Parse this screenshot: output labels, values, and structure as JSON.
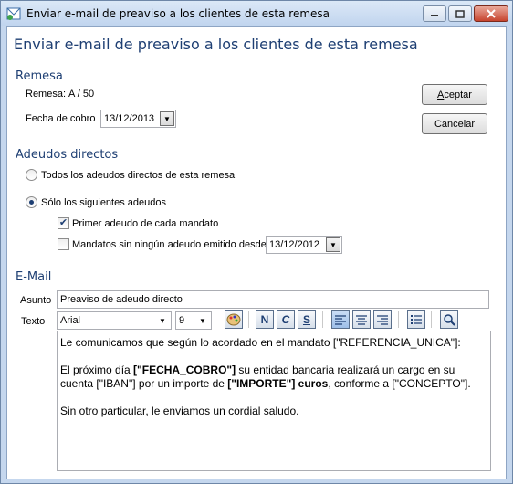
{
  "window": {
    "title": "Enviar e-mail de preaviso a los clientes de esta remesa"
  },
  "header": {
    "title": "Enviar e-mail de preaviso a los clientes de esta remesa"
  },
  "remesa": {
    "section": "Remesa",
    "remesa_label": "Remesa:",
    "remesa_value": "A / 50",
    "fecha_label": "Fecha de cobro",
    "fecha_value": "13/12/2013"
  },
  "buttons": {
    "accept_hotkey": "A",
    "accept_rest": "ceptar",
    "cancel": "Cancelar"
  },
  "adeudos": {
    "section": "Adeudos directos",
    "option_all": "Todos los adeudos directos de esta remesa",
    "option_some": "Sólo los siguientes adeudos",
    "selected": "option_some",
    "check_primer": "Primer adeudo de cada mandato",
    "check_primer_checked": true,
    "check_mandatos": "Mandatos sin ningún adeudo emitido desde",
    "check_mandatos_checked": false,
    "mandatos_fecha": "13/12/2012"
  },
  "email": {
    "section": "E-Mail",
    "asunto_label": "Asunto",
    "asunto_value": "Preaviso de adeudo directo",
    "texto_label": "Texto",
    "font": "Arial",
    "size": "9",
    "bold": "N",
    "italic": "C",
    "underline": "S",
    "body": {
      "line1": "Le comunicamos que según lo acordado en el mandato [\"REFERENCIA_UNICA\"]:",
      "p2_a": "El próximo día ",
      "p2_b": "[\"FECHA_COBRO\"]",
      "p2_c": " su entidad bancaria realizará un cargo en su cuenta [\"IBAN\"] por un importe de ",
      "p2_d": "[\"IMPORTE\"] euros",
      "p2_e": ", conforme a [\"CONCEPTO\"].",
      "line3": "Sin otro particular, le enviamos un cordial saludo."
    }
  }
}
